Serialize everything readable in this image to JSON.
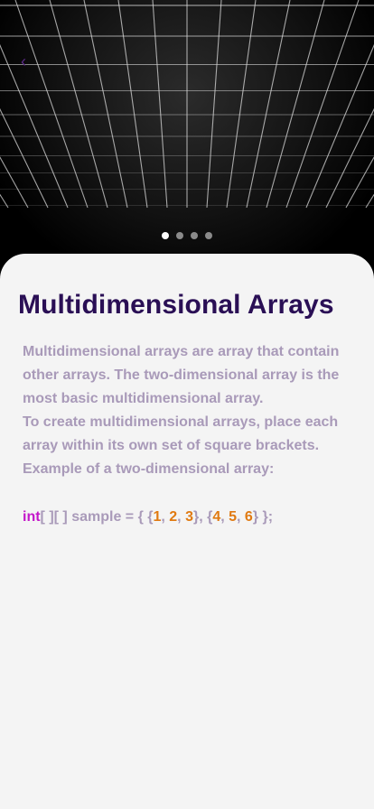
{
  "header": {
    "back_icon": "chevron-left-icon",
    "back_glyph": "‹"
  },
  "pager": {
    "pages": 4,
    "active": 0
  },
  "lesson": {
    "title": "Multidimensional Arrays",
    "paragraphs": [
      "Multidimensional arrays are array that contain other arrays. The two-dimensional array is the most basic multidimensional array.",
      "To create multidimensional arrays, place each array within its own set of square brackets.",
      "Example of a two-dimensional array:"
    ],
    "code": {
      "keyword": "int",
      "brackets": "[ ][ ]",
      "declaration": " sample = { {",
      "row1": [
        "1",
        "2",
        "3"
      ],
      "row2": [
        "4",
        "5",
        "6"
      ],
      "sep": ", ",
      "mid": "}, {",
      "end": "} };"
    }
  },
  "colors": {
    "title": "#2a0f55",
    "body_text": "#a99ab9",
    "keyword": "#c317c9",
    "number": "#e07a12",
    "card_bg": "#f4f4f4"
  }
}
